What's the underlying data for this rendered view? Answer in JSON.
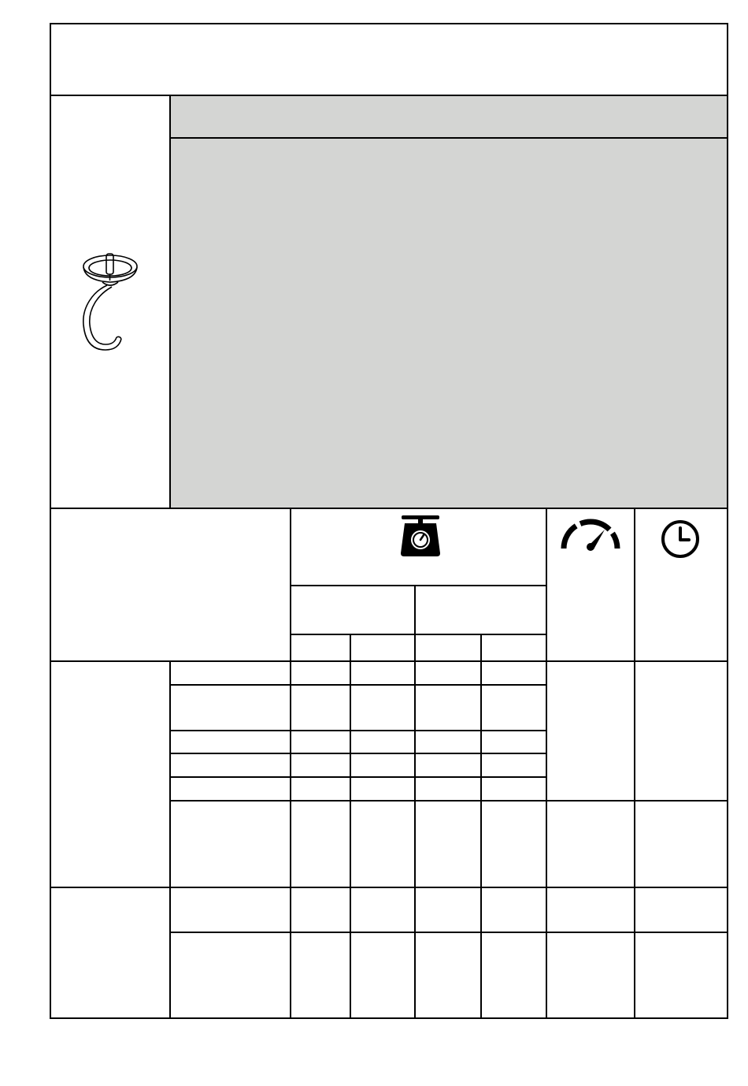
{
  "document": {
    "title": "",
    "accessory_name": "",
    "accessory_description": "",
    "header_label": ""
  },
  "table": {
    "column_headers": {
      "weight_icon": "scale-icon",
      "speed_icon": "speedometer-icon",
      "time_icon": "clock-icon"
    },
    "group_a_rows": 6,
    "group_b_rows": 2
  },
  "colors": {
    "panel_gray": "#d4d5d3",
    "line": "#000000"
  }
}
